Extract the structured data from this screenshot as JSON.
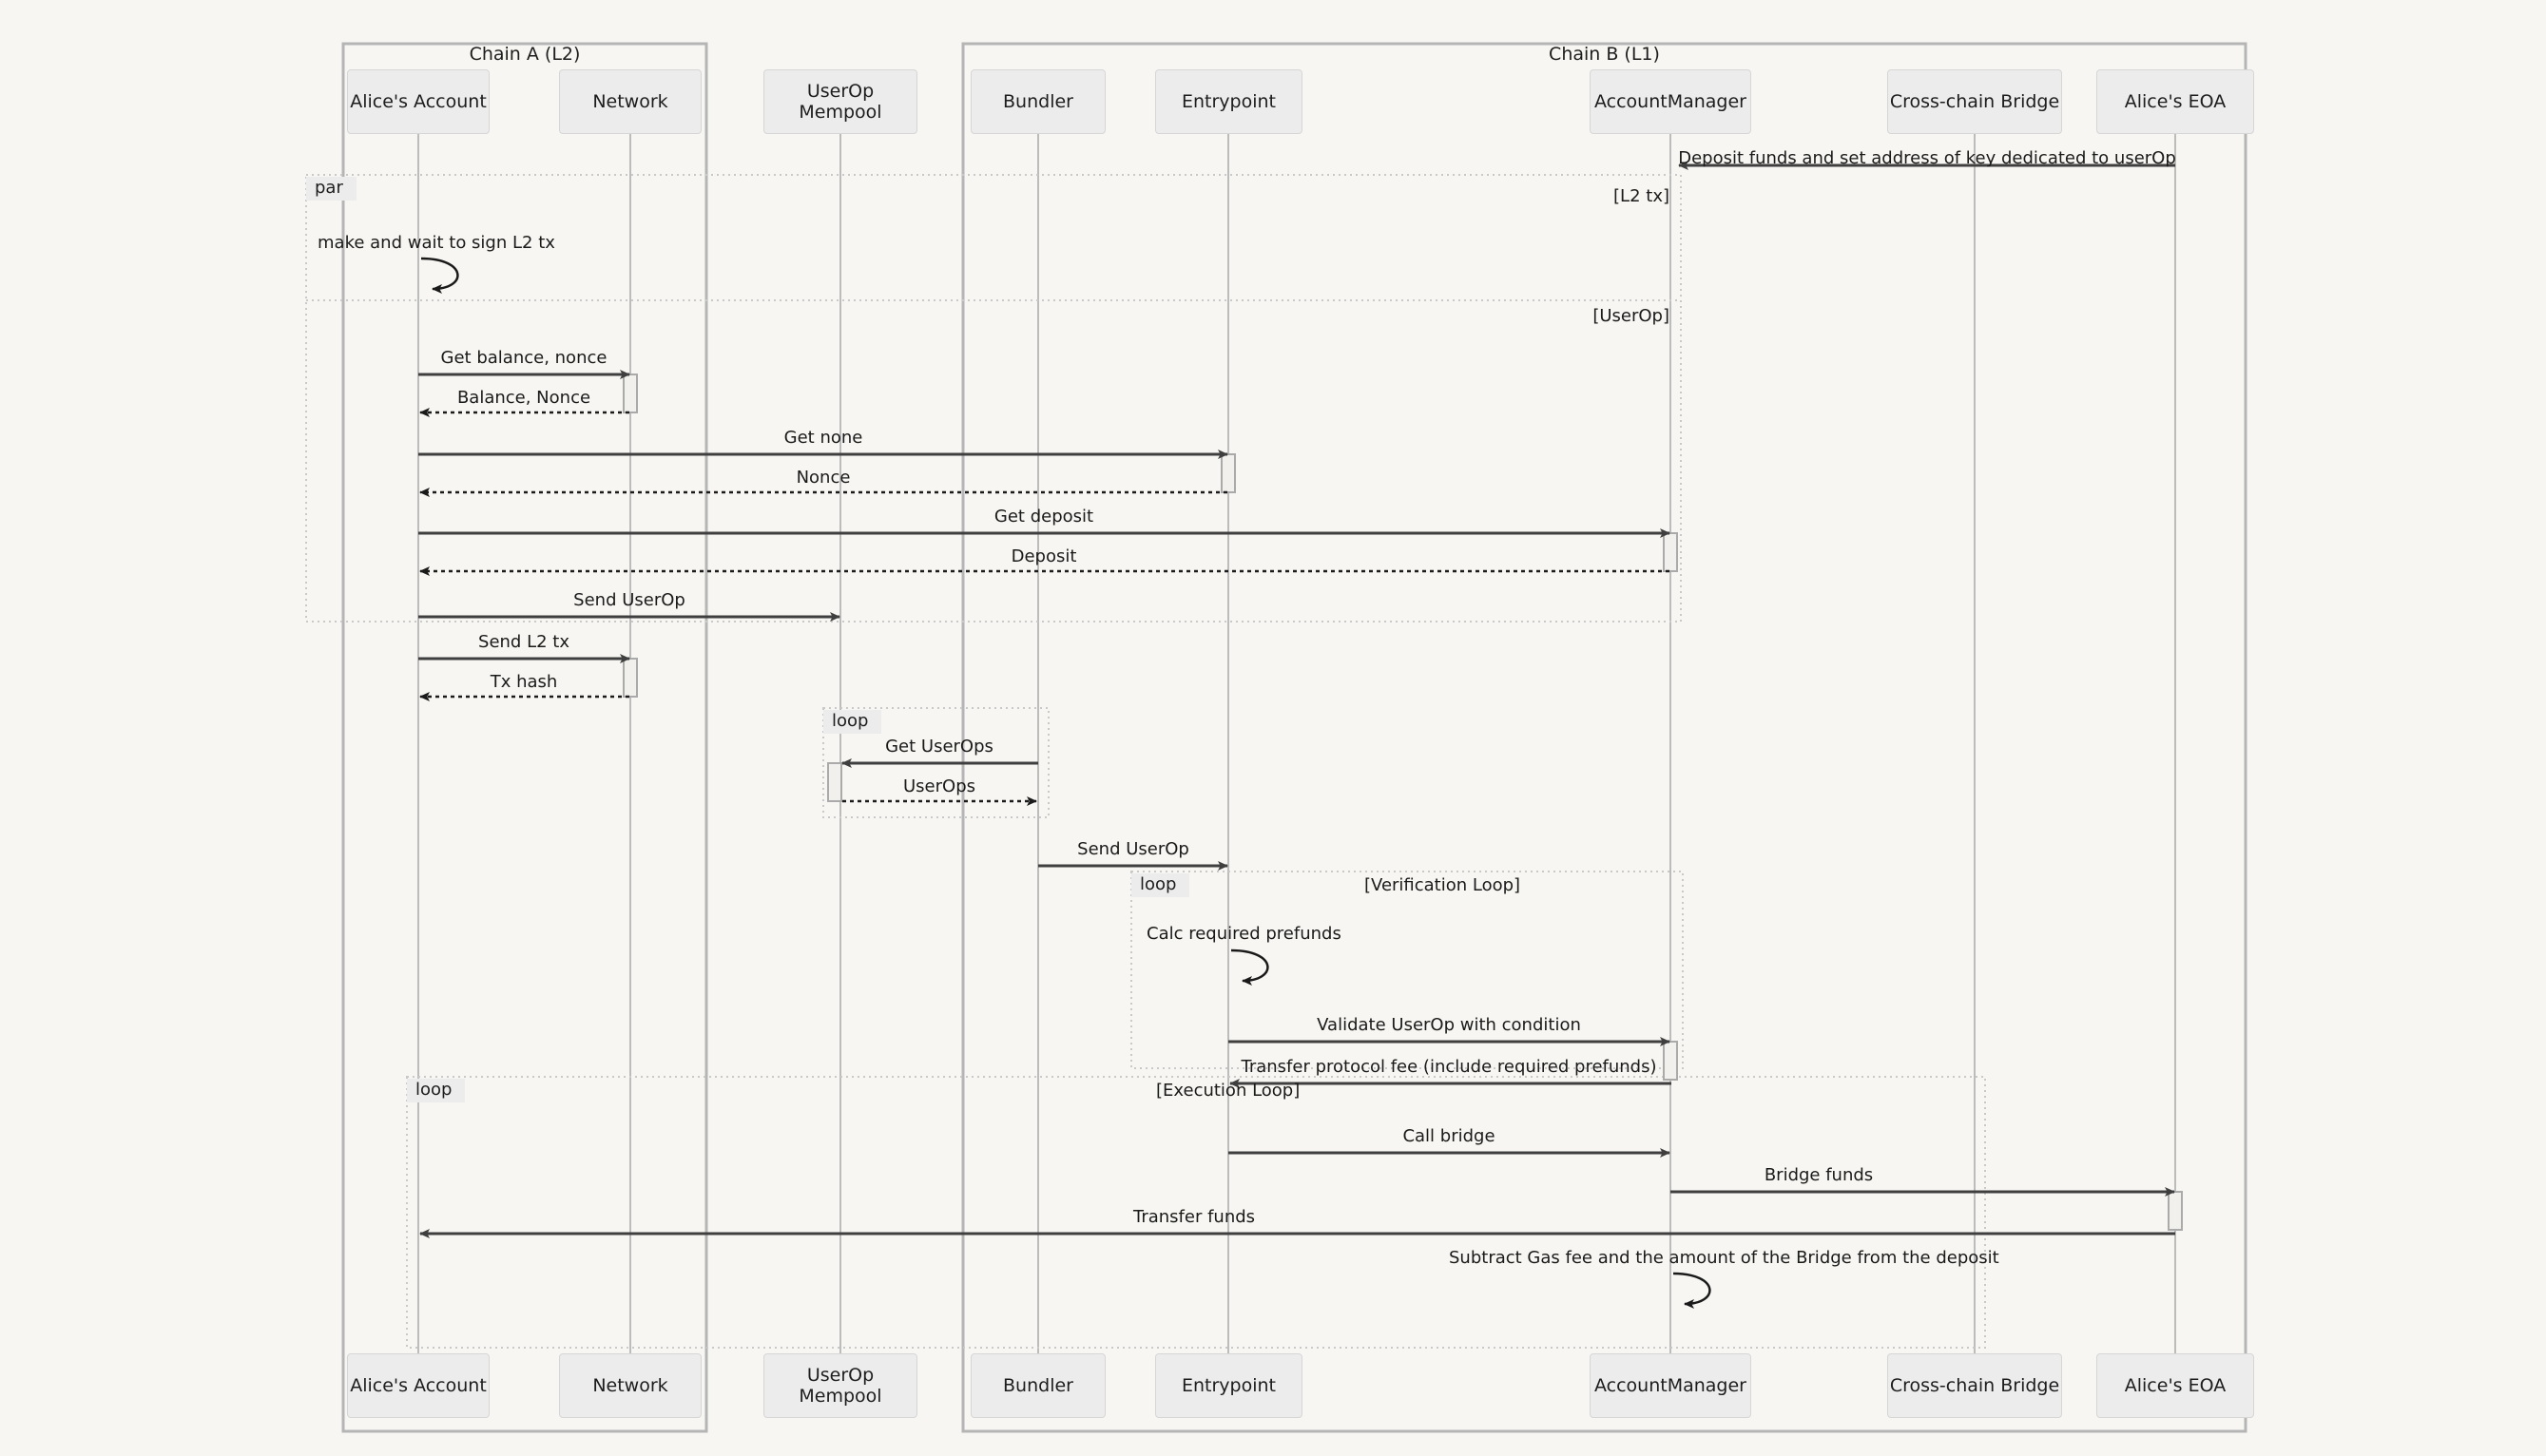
{
  "diagram": {
    "type": "sequence-diagram",
    "title": "",
    "background_color": "#f7f6f2",
    "groups": [
      {
        "id": "chain_a",
        "label": "Chain A (L2)"
      },
      {
        "id": "chain_b",
        "label": "Chain B (L1)"
      }
    ],
    "participants": [
      {
        "id": "alice_account",
        "label": "Alice's Account",
        "group": "chain_a"
      },
      {
        "id": "network",
        "label": "Network",
        "group": "chain_a"
      },
      {
        "id": "userop_mempool",
        "label": "UserOp Mempool",
        "group": null
      },
      {
        "id": "bundler",
        "label": "Bundler",
        "group": "chain_b"
      },
      {
        "id": "entrypoint",
        "label": "Entrypoint",
        "group": "chain_b"
      },
      {
        "id": "account_manager",
        "label": "AccountManager",
        "group": "chain_b"
      },
      {
        "id": "cross_chain_bridge",
        "label": "Cross-chain Bridge",
        "group": "chain_b"
      },
      {
        "id": "alice_eoa",
        "label": "Alice's EOA",
        "group": "chain_b"
      }
    ],
    "fragments": [
      {
        "id": "par1",
        "tag": "par",
        "conditions": [
          "[L2 tx]",
          "[UserOp]"
        ]
      },
      {
        "id": "loop1",
        "tag": "loop",
        "conditions": []
      },
      {
        "id": "loop2",
        "tag": "loop",
        "conditions": [
          "[Verification Loop]"
        ]
      },
      {
        "id": "loop3",
        "tag": "loop",
        "conditions": [
          "[Execution Loop]"
        ]
      }
    ],
    "messages": [
      {
        "id": "m1",
        "label": "Deposit funds and set address of key dedicated to userOp",
        "from": "alice_eoa",
        "to": "account_manager",
        "style": "solid",
        "direction": "left"
      },
      {
        "id": "m2",
        "label": "make and wait to sign L2 tx",
        "from": "alice_account",
        "to": "alice_account",
        "style": "self",
        "direction": "self"
      },
      {
        "id": "m3",
        "label": "Get balance, nonce",
        "from": "alice_account",
        "to": "network",
        "style": "solid",
        "direction": "right"
      },
      {
        "id": "m4",
        "label": "Balance, Nonce",
        "from": "network",
        "to": "alice_account",
        "style": "dotted",
        "direction": "left"
      },
      {
        "id": "m5",
        "label": "Get none",
        "from": "alice_account",
        "to": "entrypoint",
        "style": "solid",
        "direction": "right"
      },
      {
        "id": "m6",
        "label": "Nonce",
        "from": "entrypoint",
        "to": "alice_account",
        "style": "dotted",
        "direction": "left"
      },
      {
        "id": "m7",
        "label": "Get deposit",
        "from": "alice_account",
        "to": "account_manager",
        "style": "solid",
        "direction": "right"
      },
      {
        "id": "m8",
        "label": "Deposit",
        "from": "account_manager",
        "to": "alice_account",
        "style": "dotted",
        "direction": "left"
      },
      {
        "id": "m9",
        "label": "Send UserOp",
        "from": "alice_account",
        "to": "userop_mempool",
        "style": "solid",
        "direction": "right"
      },
      {
        "id": "m10",
        "label": "Send L2 tx",
        "from": "alice_account",
        "to": "network",
        "style": "solid",
        "direction": "right"
      },
      {
        "id": "m11",
        "label": "Tx hash",
        "from": "network",
        "to": "alice_account",
        "style": "dotted",
        "direction": "left"
      },
      {
        "id": "m12",
        "label": "Get UserOps",
        "from": "bundler",
        "to": "userop_mempool",
        "style": "solid",
        "direction": "left"
      },
      {
        "id": "m13",
        "label": "UserOps",
        "from": "userop_mempool",
        "to": "bundler",
        "style": "dotted",
        "direction": "right"
      },
      {
        "id": "m14",
        "label": "Send UserOp",
        "from": "bundler",
        "to": "entrypoint",
        "style": "solid",
        "direction": "right"
      },
      {
        "id": "m15",
        "label": "Calc required prefunds",
        "from": "entrypoint",
        "to": "entrypoint",
        "style": "self",
        "direction": "self"
      },
      {
        "id": "m16",
        "label": "Validate UserOp with condition",
        "from": "entrypoint",
        "to": "account_manager",
        "style": "solid",
        "direction": "right"
      },
      {
        "id": "m17",
        "label": "Transfer protocol fee (include required prefunds)",
        "from": "account_manager",
        "to": "entrypoint",
        "style": "solid",
        "direction": "left"
      },
      {
        "id": "m18",
        "label": "Call bridge",
        "from": "entrypoint",
        "to": "account_manager",
        "style": "solid",
        "direction": "right"
      },
      {
        "id": "m19",
        "label": "Bridge funds",
        "from": "account_manager",
        "to": "cross_chain_bridge",
        "style": "solid",
        "direction": "right"
      },
      {
        "id": "m20",
        "label": "Transfer funds",
        "from": "cross_chain_bridge",
        "to": "alice_account",
        "style": "solid",
        "direction": "left"
      },
      {
        "id": "m21",
        "label": "Subtract Gas fee and the amount of the Bridge from the deposit",
        "from": "account_manager",
        "to": "account_manager",
        "style": "self",
        "direction": "self"
      }
    ],
    "colors": {
      "background": "#f7f6f2",
      "participant_fill": "#ececec",
      "participant_border": "#d6d6d6",
      "lifeline": "#bcbcbc",
      "arrow": "#3f3f3f",
      "frame_border": "#b5b5b5",
      "fragment_border": "#c9c9c9",
      "text": "#1a1a1a"
    }
  }
}
